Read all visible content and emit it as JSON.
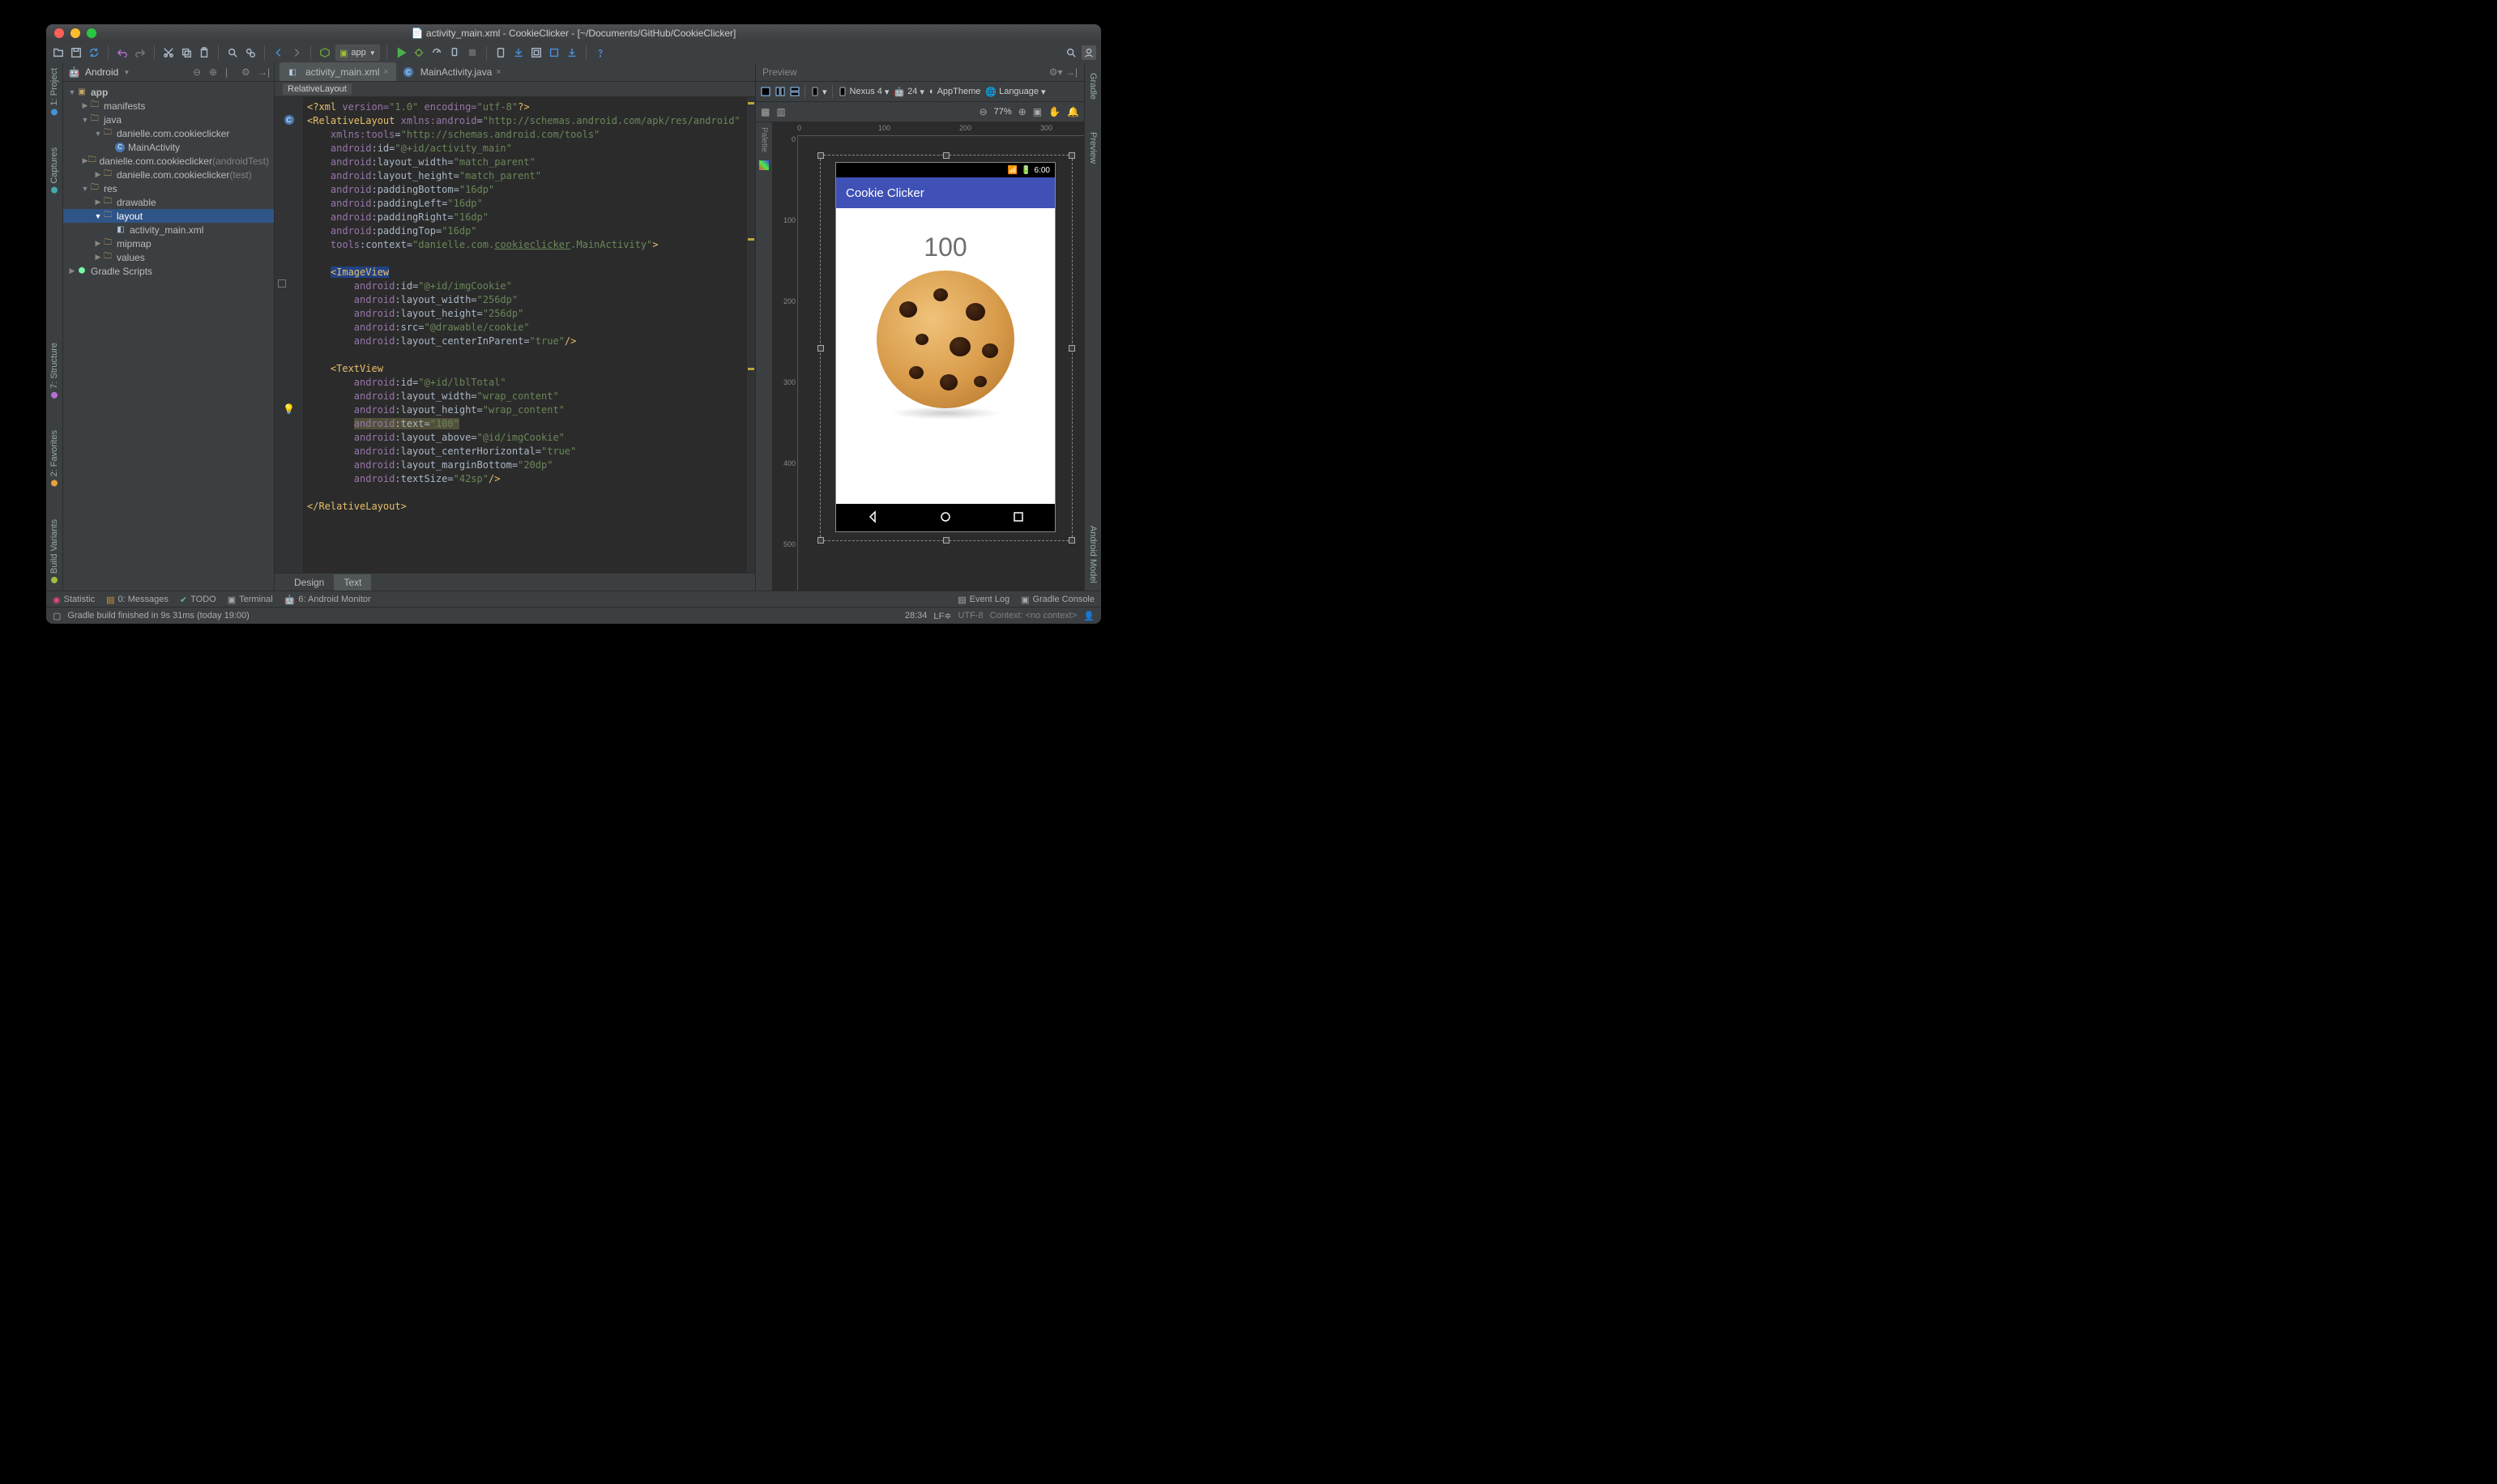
{
  "window": {
    "title_file": "activity_main.xml",
    "title_project": "CookieClicker",
    "title_path": "[~/Documents/GitHub/CookieClicker]"
  },
  "toolbar": {
    "run_config": "app"
  },
  "left_gutter": {
    "project": "1: Project",
    "captures": "Captures",
    "structure": "7: Structure",
    "favorites": "2: Favorites",
    "build_variants": "Build Variants"
  },
  "right_gutter": {
    "gradle": "Gradle",
    "preview": "Preview",
    "android_model": "Android Model"
  },
  "project_panel": {
    "header": "Android",
    "tree": {
      "app": "app",
      "manifests": "manifests",
      "java": "java",
      "pkg1": "danielle.com.cookieclicker",
      "main_activity": "MainActivity",
      "pkg2": "danielle.com.cookieclicker",
      "pkg2_suffix": "(androidTest)",
      "pkg3": "danielle.com.cookieclicker",
      "pkg3_suffix": "(test)",
      "res": "res",
      "drawable": "drawable",
      "layout": "layout",
      "activity_main": "activity_main.xml",
      "mipmap": "mipmap",
      "values": "values",
      "gradle_scripts": "Gradle Scripts"
    }
  },
  "tabs": {
    "t0": {
      "label": "activity_main.xml"
    },
    "t1": {
      "label": "MainActivity.java"
    }
  },
  "crumb": "RelativeLayout",
  "code": {
    "l1a": "<?xml ",
    "l1b": "version=",
    "l1c": "\"1.0\"",
    "l1d": " encoding=",
    "l1e": "\"utf-8\"",
    "l1f": "?>",
    "l2a": "<RelativeLayout ",
    "l2b": "xmlns:",
    "l2c": "android",
    "l2d": "=",
    "l2e": "\"http://schemas.android.com/apk/res/android\"",
    "l3a": "xmlns:",
    "l3b": "tools",
    "l3c": "=",
    "l3d": "\"http://schemas.android.com/tools\"",
    "l4a": "android",
    "l4b": ":id=",
    "l4c": "\"@+id/activity_main\"",
    "l5a": "android",
    "l5b": ":layout_width=",
    "l5c": "\"match_parent\"",
    "l6a": "android",
    "l6b": ":layout_height=",
    "l6c": "\"match_parent\"",
    "l7a": "android",
    "l7b": ":paddingBottom=",
    "l7c": "\"16dp\"",
    "l8a": "android",
    "l8b": ":paddingLeft=",
    "l8c": "\"16dp\"",
    "l9a": "android",
    "l9b": ":paddingRight=",
    "l9c": "\"16dp\"",
    "l10a": "android",
    "l10b": ":paddingTop=",
    "l10c": "\"16dp\"",
    "l11a": "tools",
    "l11b": ":context=",
    "l11c": "\"danielle.com.",
    "l11d": "cookieclicker",
    "l11e": ".MainActivity\"",
    "l11f": ">",
    "l13a": "<ImageView",
    "l14a": "android",
    "l14b": ":id=",
    "l14c": "\"@+id/imgCookie\"",
    "l15a": "android",
    "l15b": ":layout_width=",
    "l15c": "\"256dp\"",
    "l16a": "android",
    "l16b": ":layout_height=",
    "l16c": "\"256dp\"",
    "l17a": "android",
    "l17b": ":src=",
    "l17c": "\"@drawable/cookie\"",
    "l18a": "android",
    "l18b": ":layout_centerInParent=",
    "l18c": "\"true\"",
    "l18d": "/>",
    "l20a": "<TextView",
    "l21a": "android",
    "l21b": ":id=",
    "l21c": "\"@+id/lblTotal\"",
    "l22a": "android",
    "l22b": ":layout_width=",
    "l22c": "\"wrap_content\"",
    "l23a": "android",
    "l23b": ":layout_height=",
    "l23c": "\"wrap_content\"",
    "l24a": "android",
    "l24b": ":text=",
    "l24c": "\"100\"",
    "l25a": "android",
    "l25b": ":layout_above=",
    "l25c": "\"@id/imgCookie\"",
    "l26a": "android",
    "l26b": ":layout_centerHorizontal=",
    "l26c": "\"true\"",
    "l27a": "android",
    "l27b": ":layout_marginBottom=",
    "l27c": "\"20dp\"",
    "l28a": "android",
    "l28b": ":textSize=",
    "l28c": "\"42sp\"",
    "l28d": "/>",
    "l30a": "</RelativeLayout>"
  },
  "bottom_tabs": {
    "design": "Design",
    "text": "Text"
  },
  "preview": {
    "title": "Preview",
    "device": "Nexus 4",
    "api": "24",
    "theme": "AppTheme",
    "lang": "Language",
    "zoom": "77%",
    "ruler_h": {
      "r0": "0",
      "r1": "100",
      "r2": "200",
      "r3": "300"
    },
    "ruler_v": {
      "r0": "0",
      "r1": "100",
      "r2": "200",
      "r3": "300",
      "r4": "400",
      "r5": "500"
    },
    "status_time": "6:00",
    "app_title": "Cookie Clicker",
    "label_value": "100"
  },
  "status": {
    "statistic": "Statistic",
    "messages": "0: Messages",
    "todo": "TODO",
    "terminal": "Terminal",
    "monitor": "6: Android Monitor",
    "eventlog": "Event Log",
    "gradleconsole": "Gradle Console"
  },
  "build": {
    "msg": "Gradle build finished in 9s 31ms (today 19:00)",
    "pos": "28:34",
    "le": "LF",
    "enc": "UTF-8",
    "ctx": "Context:",
    "ctx2": "<no context>"
  }
}
